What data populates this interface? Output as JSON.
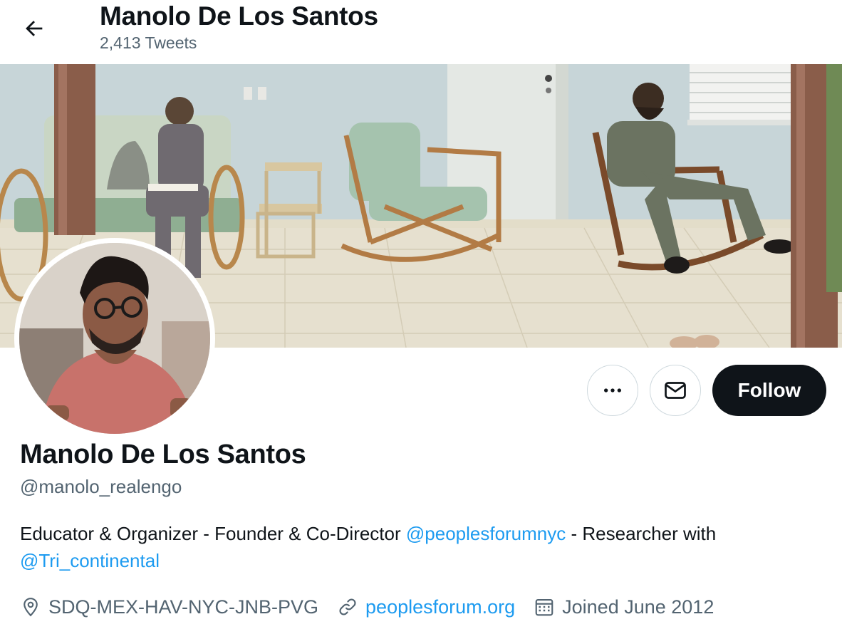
{
  "header": {
    "title": "Manolo De Los Santos",
    "tweet_count": "2,413 Tweets"
  },
  "actions": {
    "follow_label": "Follow"
  },
  "profile": {
    "name": "Manolo De Los Santos",
    "handle": "@manolo_realengo",
    "bio": {
      "text_1": "Educator & Organizer - Founder & Co-Director ",
      "mention_1": "@peoplesforumnyc",
      "text_2": " - Researcher with ",
      "mention_2": "@Tri_continental"
    },
    "location": "SDQ-MEX-HAV-NYC-JNB-PVG",
    "website": "peoplesforum.org",
    "joined": "Joined June 2012"
  },
  "icons": {
    "back": "arrow-left-icon",
    "more": "more-dots-icon",
    "message": "envelope-icon",
    "location": "location-pin-icon",
    "website": "link-icon",
    "joined": "calendar-icon"
  },
  "colors": {
    "accent": "#1d9bf0",
    "text_primary": "#0f1419",
    "text_secondary": "#536471",
    "follow_bg": "#0f1419"
  }
}
